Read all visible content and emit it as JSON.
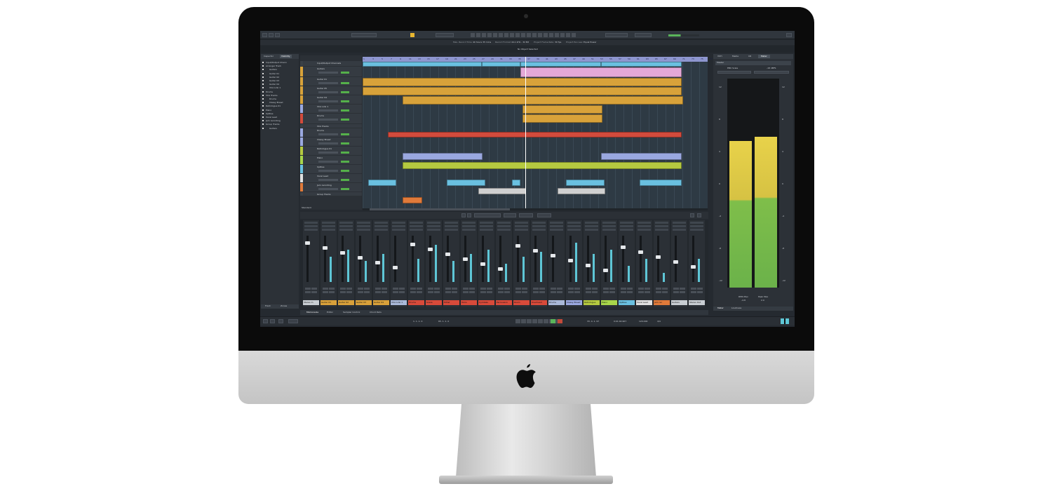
{
  "toolbar": {
    "configurations_label": "Configurations",
    "touch_mode": "Touch",
    "zoom_label": "Adapt to Zoom",
    "grid_value": "1/16",
    "status_text": "No Object Selected",
    "info_max_record": "Max. Record Time",
    "info_record_value": "40 hours 35 mins",
    "info_record_format": "Record Format",
    "info_format_value": "44.1 kHz - 32 Bit",
    "info_frame_rate": "Project Frame Rate",
    "info_frame_value": "30 fps",
    "info_pan_law": "Project Pan Law",
    "info_pan_value": "Equal Power"
  },
  "left_zone": {
    "tabs": [
      "Inspector",
      "Visibility"
    ],
    "items": [
      "Input/Output Chann",
      "Arranger Track",
      "Guitars",
      "Guitar 01",
      "Guitar 02",
      "Guitar 03",
      "Guitar 04",
      "VCA Link 1",
      "Drums",
      "VCA Tracks",
      "Drums",
      "Classy Bread",
      "Retrologue 01",
      "Piano",
      "UpRise",
      "Vocal Lead",
      "Jam recording",
      "Group Tracks",
      "Guitars"
    ],
    "bottom_tabs": [
      "Track",
      "Zones"
    ]
  },
  "tracks": [
    "Input/Output Channels",
    "Guitars",
    "Guitar 01",
    "Guitar 05",
    "Guitar 04",
    "VCA Link 1",
    "Drums",
    "VCA Tracks",
    "Drums",
    "Classy Bread",
    "Retrologue 01",
    "Piano",
    "UpRise",
    "Vocal Lead",
    "Jam recording",
    "Group Tracks"
  ],
  "track_list_footer": "Standard",
  "ruler": [
    "1",
    "3",
    "5",
    "7",
    "9",
    "11",
    "13",
    "15",
    "17",
    "19",
    "21",
    "23",
    "25",
    "27",
    "29",
    "31",
    "33",
    "35",
    "37",
    "39",
    "41",
    "43",
    "45",
    "47",
    "49",
    "51",
    "53",
    "55",
    "57",
    "59",
    "61",
    "63",
    "65",
    "67",
    "69",
    "71",
    "73",
    "75",
    "77"
  ],
  "mixer": {
    "channels": [
      "Stereo In",
      "Guitar 01",
      "Guitar 02",
      "Guitar 03",
      "Guitar 04",
      "VCA Link 1",
      "Drums",
      "Snare",
      "HiHat",
      "Toms",
      "Cymbals",
      "Percussion",
      "Room",
      "Overhead",
      "Drums",
      "Classy Bread",
      "Retrologue",
      "Piano",
      "UpRise",
      "Vocal Lead",
      "Jam rec",
      "Guitars",
      "Stereo Out"
    ],
    "channel_colors": [
      "#c8cdd2",
      "#d8a03a",
      "#d8a03a",
      "#d8a03a",
      "#d8a03a",
      "#a9b8d8",
      "#d84a3a",
      "#d84a3a",
      "#d84a3a",
      "#d84a3a",
      "#d84a3a",
      "#d84a3a",
      "#d84a3a",
      "#d84a3a",
      "#a9b8d8",
      "#9aa8e0",
      "#b5c940",
      "#a8d64a",
      "#6ac0e0",
      "#e0e0e0",
      "#e07a3a",
      "#c8cdd2",
      "#c8cdd2"
    ],
    "levels": [
      0.0,
      0.55,
      0.7,
      0.45,
      0.6,
      0.0,
      0.5,
      0.8,
      0.45,
      0.6,
      0.7,
      0.4,
      0.55,
      0.65,
      0.0,
      0.85,
      0.6,
      0.7,
      0.35,
      0.5,
      0.2,
      0.0,
      0.5
    ],
    "bottom_tabs": [
      "MixConsole",
      "Editor",
      "Sampler Control",
      "Chord Pads"
    ],
    "header_labels": [
      "Drums",
      "Drums",
      "Drums",
      "Drums",
      "Drums",
      "Drums",
      "Drums"
    ]
  },
  "right_zone": {
    "tabs": [
      "VSTi",
      "Media",
      "CR",
      "Meter"
    ],
    "meter_title": "Master",
    "scale_label": "EBU Scale",
    "scale_value": "-18 dBFS",
    "scale_left": "ALL",
    "scale_right": "DB",
    "scale_marks": [
      "12",
      "8",
      "4",
      "0",
      "-4",
      "-8",
      "-12"
    ],
    "levels": [
      0.7,
      0.72
    ],
    "rms_label": "RMS Max",
    "rms_value": "-4.8",
    "peak_label": "Peak Max",
    "peak_value": "2.0",
    "bottom_tabs": [
      "Meter",
      "Loudness"
    ]
  },
  "transport": {
    "left_locator": "1. 1. 1. 0",
    "right_locator": "65. 1. 1. 0",
    "position": "33. 4. 1. 97",
    "time": "0:01:02.907",
    "tempo": "120.000",
    "signature": "4/4"
  },
  "colors": {
    "accent": "#e8b630",
    "guitar": "#d8a23a",
    "drums": "#d24b3c",
    "synth": "#b5c940",
    "arranger": "#6ac0e0",
    "vca": "#9aa8e0"
  }
}
